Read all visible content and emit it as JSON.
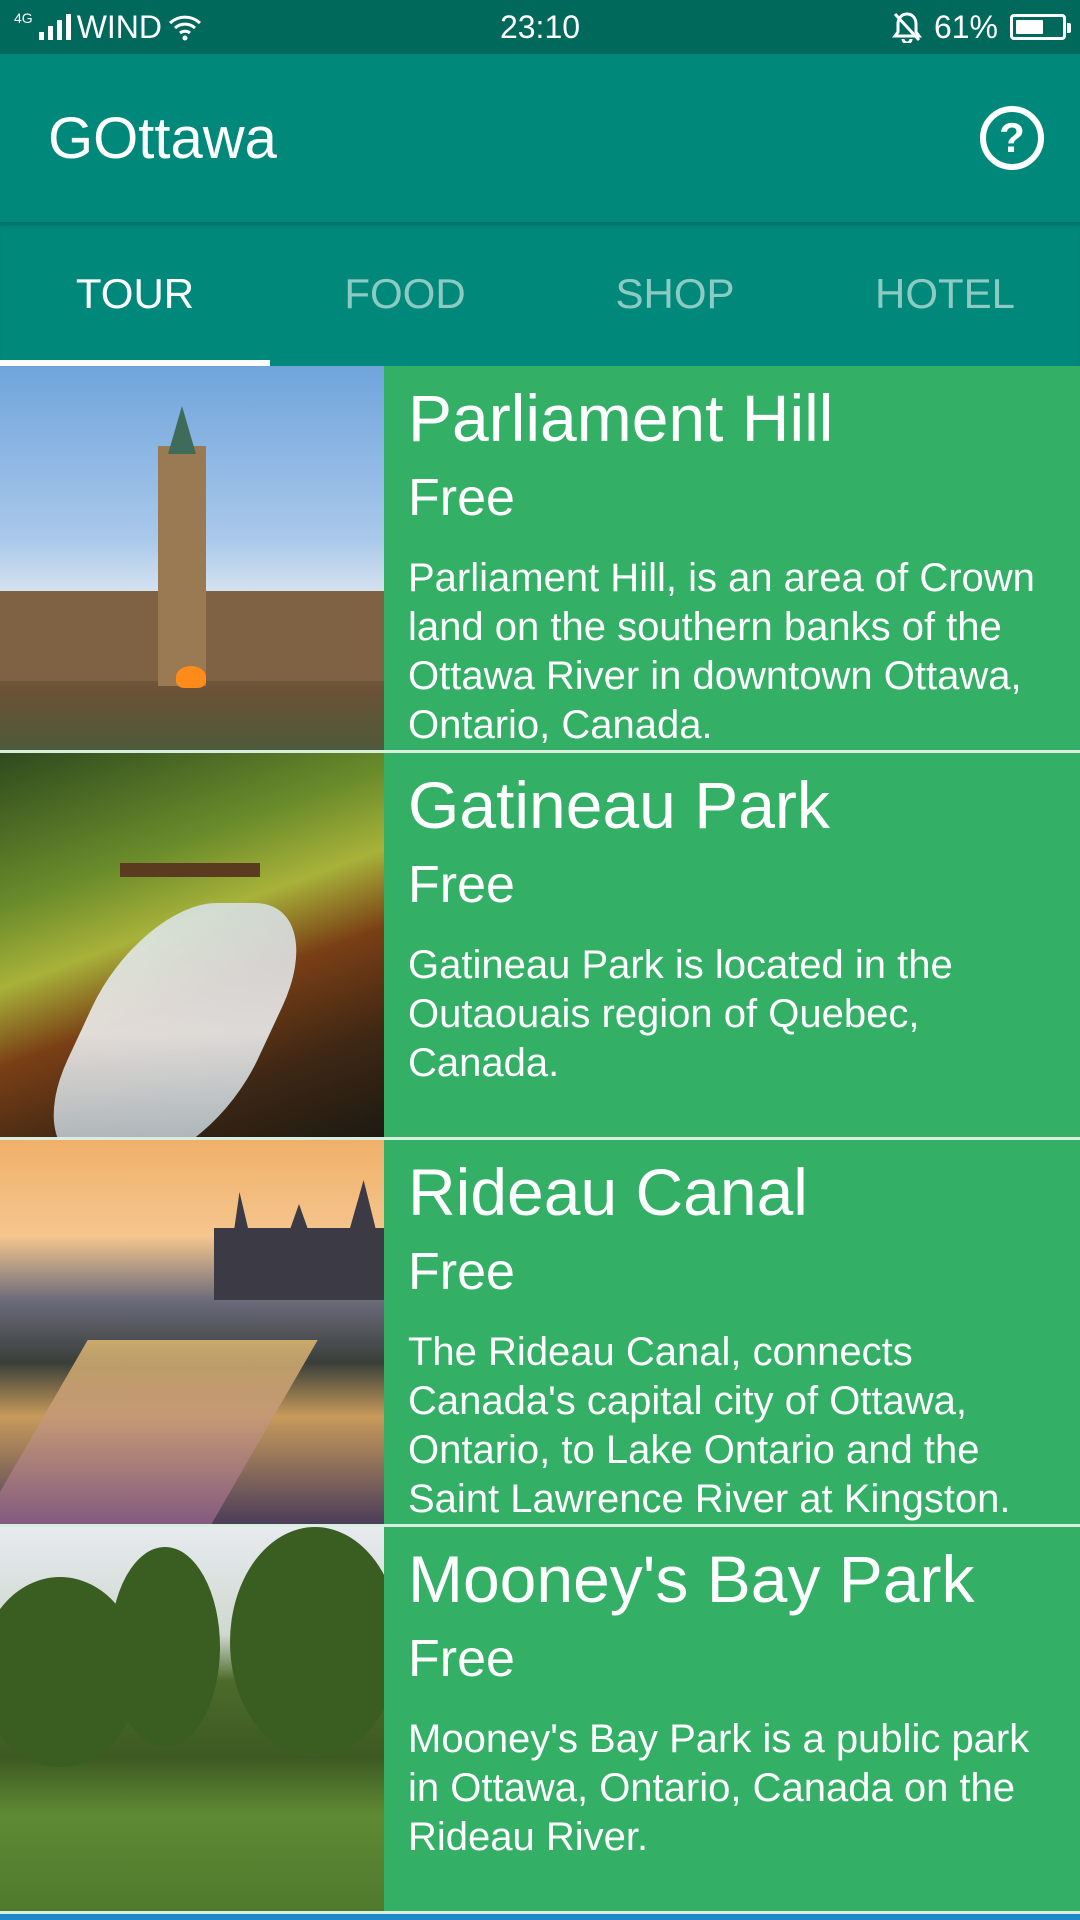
{
  "status_bar": {
    "network": "4G",
    "carrier": "WIND",
    "time": "23:10",
    "battery": "61%",
    "battery_level": 0.61
  },
  "app_bar": {
    "title": "GOttawa",
    "help_icon": "help-circle-icon"
  },
  "tabs": [
    {
      "label": "TOUR",
      "active": true
    },
    {
      "label": "FOOD",
      "active": false
    },
    {
      "label": "SHOP",
      "active": false
    },
    {
      "label": "HOTEL",
      "active": false
    }
  ],
  "places": [
    {
      "name": "Parliament Hill",
      "price": "Free",
      "description": "Parliament Hill, is an area of Crown land on the southern banks of the Ottawa River in downtown Ottawa, Ontario, Canada."
    },
    {
      "name": "Gatineau Park",
      "price": "Free",
      "description": "Gatineau Park is located in the Outaouais region of Quebec, Canada."
    },
    {
      "name": "Rideau Canal",
      "price": "Free",
      "description": "The Rideau Canal, connects Canada's capital city of Ottawa, Ontario, to Lake Ontario and the Saint Lawrence River at Kingston."
    },
    {
      "name": "Mooney's Bay Park",
      "price": "Free",
      "description": "Mooney's Bay Park is a public park in Ottawa, Ontario, Canada on the Rideau River."
    }
  ],
  "colors": {
    "status_bar": "#00695c",
    "primary": "#00897b",
    "list_background": "#33b065",
    "divider": "#d8efe0"
  }
}
